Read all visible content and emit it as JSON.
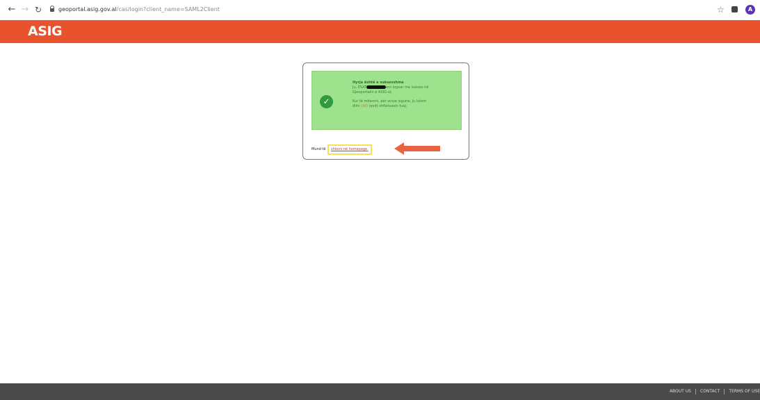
{
  "browser": {
    "back_icon": "arrow-left-icon",
    "forward_icon": "arrow-right-icon",
    "reload_icon": "reload-icon",
    "url_host": "geoportal.asig.gov.al",
    "url_path": "/cas/login?client_name=SAML2Client",
    "avatar_letter": "A"
  },
  "header": {
    "logo_text": "ASIG",
    "color": "#e8522d"
  },
  "alert": {
    "title": "Hyrja është e suksesshme",
    "line1_before": "Ju, ",
    "line1_name": "ESAT",
    "line1_after": "eni loguar me sukses në",
    "line2": "Gjeoportalin e ASIG-ut.",
    "line3": "Kur të mbaroni, për arsye sigurie, ju lutem",
    "line4_before": "dilni ",
    "line4_link": "(dil)",
    "line4_after": " (exit) shfletuesin tuaj.",
    "color": "#9ee28e"
  },
  "login": {
    "prefix": "Mund të",
    "link_text": "shkoni në homepage",
    "suffix": "."
  },
  "footer": {
    "about": "ABOUT US",
    "contact": "CONTACT",
    "terms": "TERMS OF USE"
  }
}
